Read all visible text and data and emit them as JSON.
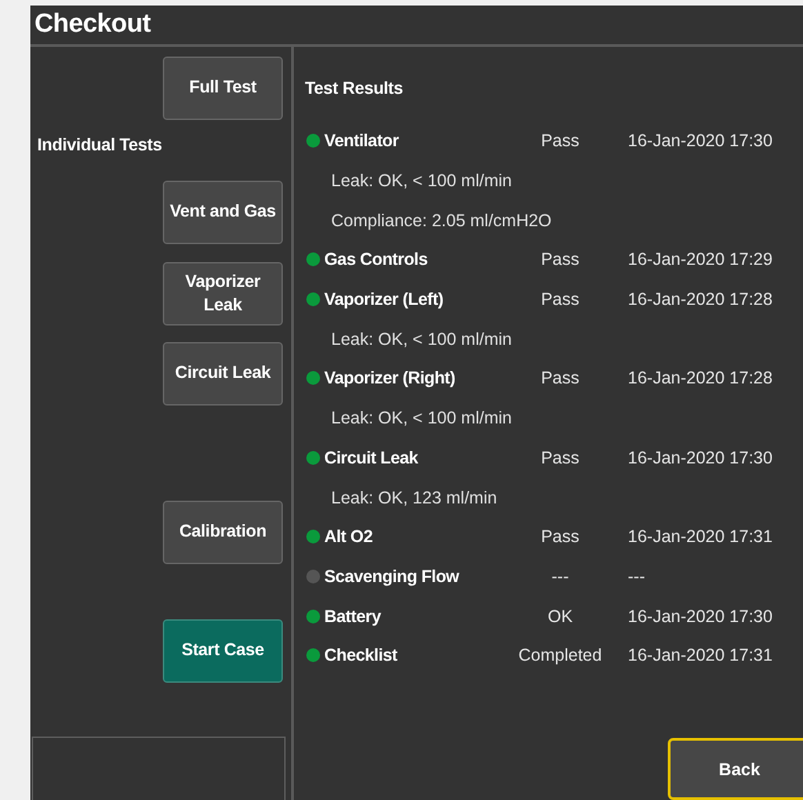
{
  "title": "Checkout",
  "full_test_button": "Full Test",
  "individual_tests_label": "Individual Tests",
  "test_buttons": [
    {
      "label": "Vent and Gas",
      "kind": "normal"
    },
    {
      "label": "Vaporizer Leak",
      "kind": "normal"
    },
    {
      "label": "Circuit Leak",
      "kind": "normal"
    },
    {
      "label": "Calibration",
      "kind": "normal"
    },
    {
      "label": "Start Case",
      "kind": "primary"
    }
  ],
  "results_title": "Test Results",
  "results": [
    {
      "kind": "test",
      "name": "Ventilator",
      "status": "Pass",
      "time": "16-Jan-2020 17:30",
      "color": "#0a9a3c"
    },
    {
      "kind": "detail",
      "text": "Leak: OK, < 100 ml/min"
    },
    {
      "kind": "detail",
      "text": "Compliance: 2.05 ml/cmH2O"
    },
    {
      "kind": "test",
      "name": "Gas Controls",
      "status": "Pass",
      "time": "16-Jan-2020 17:29",
      "color": "#0a9a3c"
    },
    {
      "kind": "test",
      "name": "Vaporizer (Left)",
      "status": "Pass",
      "time": "16-Jan-2020 17:28",
      "color": "#0a9a3c"
    },
    {
      "kind": "detail",
      "text": "Leak: OK, < 100 ml/min"
    },
    {
      "kind": "test",
      "name": "Vaporizer (Right)",
      "status": "Pass",
      "time": "16-Jan-2020 17:28",
      "color": "#0a9a3c"
    },
    {
      "kind": "detail",
      "text": "Leak: OK, < 100 ml/min"
    },
    {
      "kind": "test",
      "name": "Circuit Leak",
      "status": "Pass",
      "time": "16-Jan-2020 17:30",
      "color": "#0a9a3c"
    },
    {
      "kind": "detail",
      "text": "Leak: OK, 123 ml/min"
    },
    {
      "kind": "test",
      "name": "Alt O2",
      "status": "Pass",
      "time": "16-Jan-2020 17:31",
      "color": "#0a9a3c"
    },
    {
      "kind": "test",
      "name": "Scavenging Flow",
      "status": "---",
      "time": "---",
      "color": "#555555"
    },
    {
      "kind": "test",
      "name": "Battery",
      "status": "OK",
      "time": "16-Jan-2020 17:30",
      "color": "#0a9a3c"
    },
    {
      "kind": "test",
      "name": "Checklist",
      "status": "Completed",
      "time": "16-Jan-2020 17:31",
      "color": "#0a9a3c"
    }
  ],
  "back_button": "Back"
}
